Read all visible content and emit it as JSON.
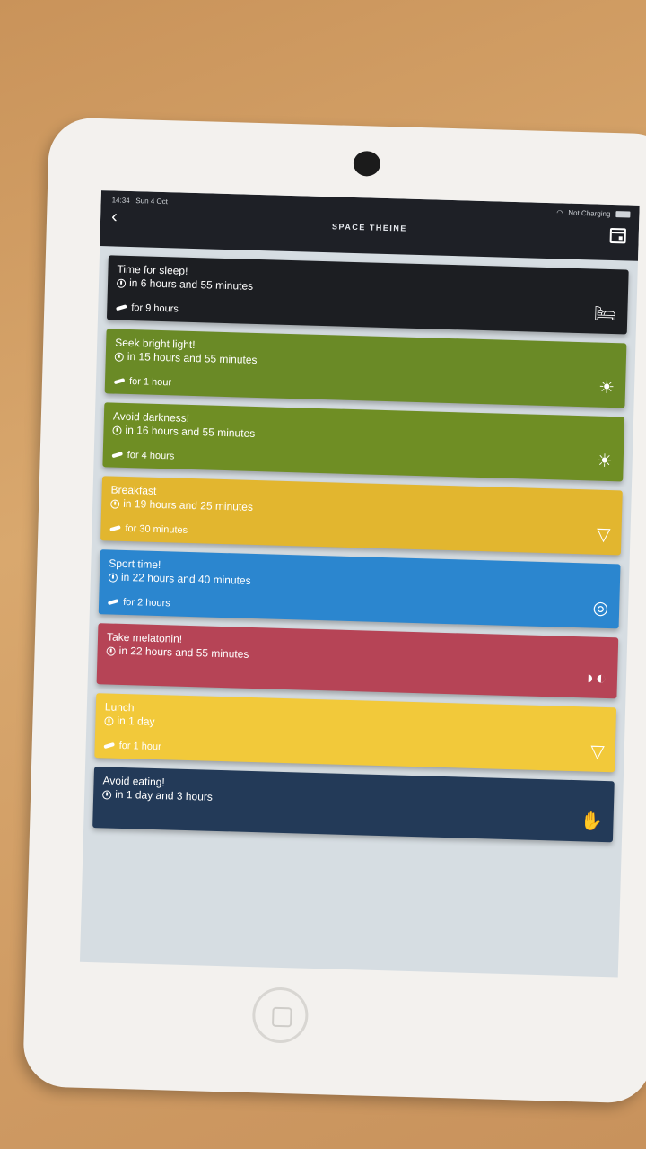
{
  "status_bar": {
    "time": "14:34",
    "date": "Sun 4 Oct",
    "charging": "Not Charging"
  },
  "header": {
    "title": "SPACE THEINE",
    "back_icon": "chevron-left-icon",
    "calendar_icon": "calendar-icon"
  },
  "events": [
    {
      "title": "Time for sleep!",
      "when": "in 6 hours and 55 minutes",
      "duration": "for 9 hours",
      "icon": "bed-icon",
      "color": "#1c1e22"
    },
    {
      "title": "Seek bright light!",
      "when": "in 15 hours and 55 minutes",
      "duration": "for 1 hour",
      "icon": "sun-icon",
      "color": "#6a8a26"
    },
    {
      "title": "Avoid darkness!",
      "when": "in 16 hours and 55 minutes",
      "duration": "for 4 hours",
      "icon": "sun-icon",
      "color": "#6f8e24"
    },
    {
      "title": "Breakfast",
      "when": "in 19 hours and 25 minutes",
      "duration": "for 30 minutes",
      "icon": "pizza-icon",
      "color": "#e2b62f"
    },
    {
      "title": "Sport time!",
      "when": "in 22 hours and 40 minutes",
      "duration": "for 2 hours",
      "icon": "basketball-icon",
      "color": "#2b86cf"
    },
    {
      "title": "Take melatonin!",
      "when": "in 22 hours and 55 minutes",
      "duration": "",
      "icon": "pills-icon",
      "color": "#b64456"
    },
    {
      "title": "Lunch",
      "when": "in 1 day",
      "duration": "for 1 hour",
      "icon": "pizza-icon",
      "color": "#f2c93a"
    },
    {
      "title": "Avoid eating!",
      "when": "in 1 day and 3 hours",
      "duration": "",
      "icon": "hand-icon",
      "color": "#233a58"
    }
  ]
}
